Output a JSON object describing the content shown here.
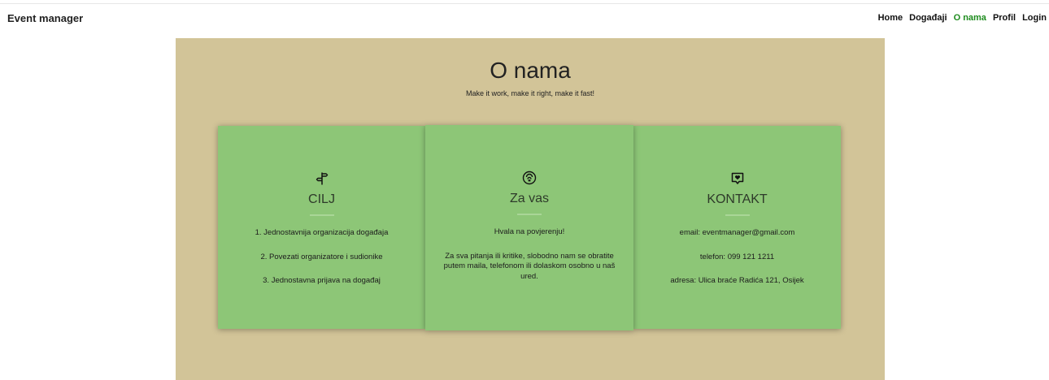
{
  "brand": "Event manager",
  "nav": {
    "home": "Home",
    "events": "Događaji",
    "about": "O nama",
    "profile": "Profil",
    "login": "Login"
  },
  "hero": {
    "title": "O nama",
    "subtitle": "Make it work, make it right, make it fast!"
  },
  "cards": [
    {
      "icon": "signpost-icon",
      "title": "CILJ",
      "lines": [
        "1. Jednostavnija organizacija događaja",
        "2. Povezati organizatore i sudionike",
        "3. Jednostavna prijava na događaj"
      ]
    },
    {
      "icon": "smile-icon",
      "title": "Za vas",
      "lines": [
        "Hvala na povjerenju!",
        "Za sva pitanja ili kritike, slobodno nam se obratite putem maila, telefonom ili dolaskom osobno u naš ured."
      ]
    },
    {
      "icon": "heart-message-icon",
      "title": "KONTAKT",
      "lines": [
        "email: eventmanager@gmail.com",
        "telefon: 099 121 1211",
        "adresa: Ulica braće Radića 121, Osijek"
      ]
    }
  ],
  "colors": {
    "hero_bg": "#d2c498",
    "card_bg": "#8dc677",
    "nav_active": "#1e8c1e"
  }
}
